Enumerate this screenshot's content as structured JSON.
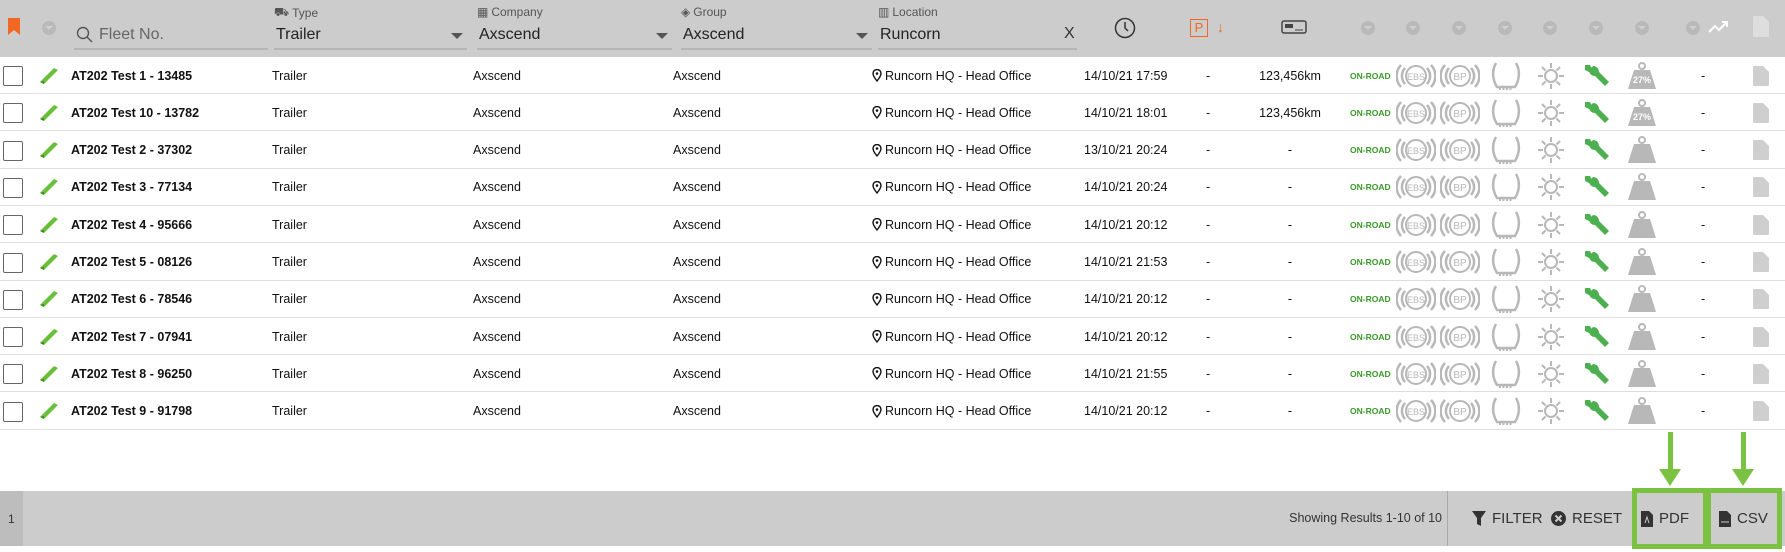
{
  "header": {
    "search_placeholder": "Fleet No.",
    "type_label": "Type",
    "type_value": "Trailer",
    "company_label": "Company",
    "company_value": "Axscend",
    "group_label": "Group",
    "group_value": "Axscend",
    "location_label": "Location",
    "location_value": "Runcorn",
    "clear_label": "X",
    "parking_label": "P"
  },
  "rows": [
    {
      "fleet": "AT202 Test 1 - 13485",
      "type": "Trailer",
      "company": "Axscend",
      "group": "Axscend",
      "location": "Runcorn HQ - Head Office",
      "time": "14/10/21 17:59",
      "park": "-",
      "odo": "123,456km",
      "status": "ON-ROAD",
      "load": "27%",
      "trend": "-"
    },
    {
      "fleet": "AT202 Test 10 - 13782",
      "type": "Trailer",
      "company": "Axscend",
      "group": "Axscend",
      "location": "Runcorn HQ - Head Office",
      "time": "14/10/21 18:01",
      "park": "-",
      "odo": "123,456km",
      "status": "ON-ROAD",
      "load": "27%",
      "trend": "-"
    },
    {
      "fleet": "AT202 Test 2 - 37302",
      "type": "Trailer",
      "company": "Axscend",
      "group": "Axscend",
      "location": "Runcorn HQ - Head Office",
      "time": "13/10/21 20:24",
      "park": "-",
      "odo": "-",
      "status": "ON-ROAD",
      "load": "",
      "trend": "-"
    },
    {
      "fleet": "AT202 Test 3 - 77134",
      "type": "Trailer",
      "company": "Axscend",
      "group": "Axscend",
      "location": "Runcorn HQ - Head Office",
      "time": "14/10/21 20:24",
      "park": "-",
      "odo": "-",
      "status": "ON-ROAD",
      "load": "",
      "trend": "-"
    },
    {
      "fleet": "AT202 Test 4 - 95666",
      "type": "Trailer",
      "company": "Axscend",
      "group": "Axscend",
      "location": "Runcorn HQ - Head Office",
      "time": "14/10/21 20:12",
      "park": "-",
      "odo": "-",
      "status": "ON-ROAD",
      "load": "",
      "trend": "-"
    },
    {
      "fleet": "AT202 Test 5 - 08126",
      "type": "Trailer",
      "company": "Axscend",
      "group": "Axscend",
      "location": "Runcorn HQ - Head Office",
      "time": "14/10/21 21:53",
      "park": "-",
      "odo": "-",
      "status": "ON-ROAD",
      "load": "",
      "trend": "-"
    },
    {
      "fleet": "AT202 Test 6 - 78546",
      "type": "Trailer",
      "company": "Axscend",
      "group": "Axscend",
      "location": "Runcorn HQ - Head Office",
      "time": "14/10/21 20:12",
      "park": "-",
      "odo": "-",
      "status": "ON-ROAD",
      "load": "",
      "trend": "-"
    },
    {
      "fleet": "AT202 Test 7 - 07941",
      "type": "Trailer",
      "company": "Axscend",
      "group": "Axscend",
      "location": "Runcorn HQ - Head Office",
      "time": "14/10/21 20:12",
      "park": "-",
      "odo": "-",
      "status": "ON-ROAD",
      "load": "",
      "trend": "-"
    },
    {
      "fleet": "AT202 Test 8 - 96250",
      "type": "Trailer",
      "company": "Axscend",
      "group": "Axscend",
      "location": "Runcorn HQ - Head Office",
      "time": "14/10/21 21:55",
      "park": "-",
      "odo": "-",
      "status": "ON-ROAD",
      "load": "",
      "trend": "-"
    },
    {
      "fleet": "AT202 Test 9 - 91798",
      "type": "Trailer",
      "company": "Axscend",
      "group": "Axscend",
      "location": "Runcorn HQ - Head Office",
      "time": "14/10/21 20:12",
      "park": "-",
      "odo": "-",
      "status": "ON-ROAD",
      "load": "",
      "trend": "-"
    }
  ],
  "icons": {
    "ebs": "EBS",
    "bp": "BP"
  },
  "footer": {
    "page": "1",
    "results": "Showing Results 1-10 of 10",
    "filter": "FILTER",
    "reset": "RESET",
    "pdf": "PDF",
    "csv": "CSV"
  },
  "colors": {
    "accent": "#f26722",
    "green": "#4caf50",
    "highlight": "#7cc242"
  }
}
